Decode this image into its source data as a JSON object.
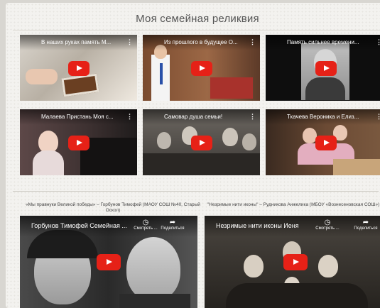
{
  "page": {
    "title": "Моя семейная реликвия"
  },
  "videos": [
    {
      "caption": "В наших руках память М...",
      "menu": "⋮",
      "colors": [
        "#c9c4bb",
        "#8c6d5a",
        "#e9e4dc"
      ]
    },
    {
      "caption": "Из прошлого в будущее О...",
      "menu": "⋮",
      "colors": [
        "#8b5a3c",
        "#6b4a38",
        "#f1f1f1"
      ]
    },
    {
      "caption": "Память сильнее времени...",
      "menu": "⋮",
      "colors": [
        "#111111",
        "#c9c9c9",
        "#2b2b2b"
      ]
    },
    {
      "caption": "Малаева Пристань Моя с...",
      "menu": "⋮",
      "colors": [
        "#4a3a3a",
        "#d8c7c0",
        "#1d1b1c"
      ]
    },
    {
      "caption": "Самовар душа семьи!",
      "menu": "⋮",
      "colors": [
        "#5a5550",
        "#b9b2a8",
        "#2f2c29"
      ]
    },
    {
      "caption": "Ткачева Вероника и Елиз...",
      "menu": "⋮",
      "colors": [
        "#5b3f2d",
        "#d9a7b3",
        "#8a6a50"
      ]
    }
  ],
  "featured": [
    {
      "heading": "«Мы правнуки Великой победы» – Горбунов Тимофей (МАОУ СОШ №40, Старый Оскол)",
      "caption": "Горбунов Тимофей Семейная ...",
      "watch_later": "Смотреть ...",
      "share": "Поделиться"
    },
    {
      "heading": "\"Незримые нити иконы\" – Рудникова Анжелика (МБОУ «Вознесеновская СОШ»)",
      "caption": "Незримые нити иконы Иеня",
      "watch_later": "Смотреть ...",
      "share": "Поделиться"
    }
  ]
}
